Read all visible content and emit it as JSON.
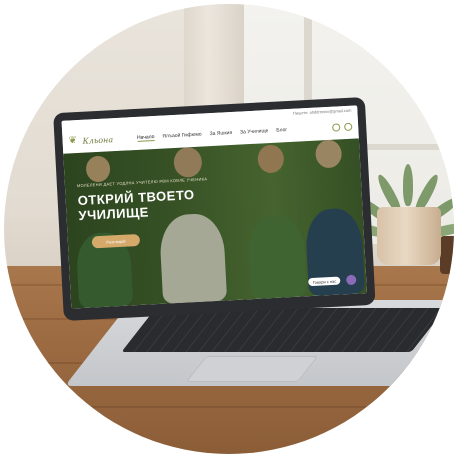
{
  "screen": {
    "topbar_email": "Пишете: ahddrmssv@gmail.com",
    "brand": "Кльона",
    "nav": [
      {
        "label": "Начало",
        "active": true
      },
      {
        "label": "Ялъаой Гмфюмо",
        "active": false
      },
      {
        "label": "За Яшкия",
        "active": false
      },
      {
        "label": "За Училище",
        "active": false
      },
      {
        "label": "Блог",
        "active": false
      }
    ],
    "hero_kicker": "МОЛЕЛЕНИ ДАЕТ УОДЛНА УЧИТЕЛЮ РВМ КОВЛЕ УЧЕНИКА",
    "hero_title": "ОТКРИЙ ТВОЕТО УЧИЛИЩЕ",
    "hero_button": "Разгледай",
    "hero_chip": "Говори с нас"
  },
  "colors": {
    "accent": "#8a9a4e",
    "hero_green": "#3f5c2c",
    "button_gold": "#d4a96a"
  }
}
